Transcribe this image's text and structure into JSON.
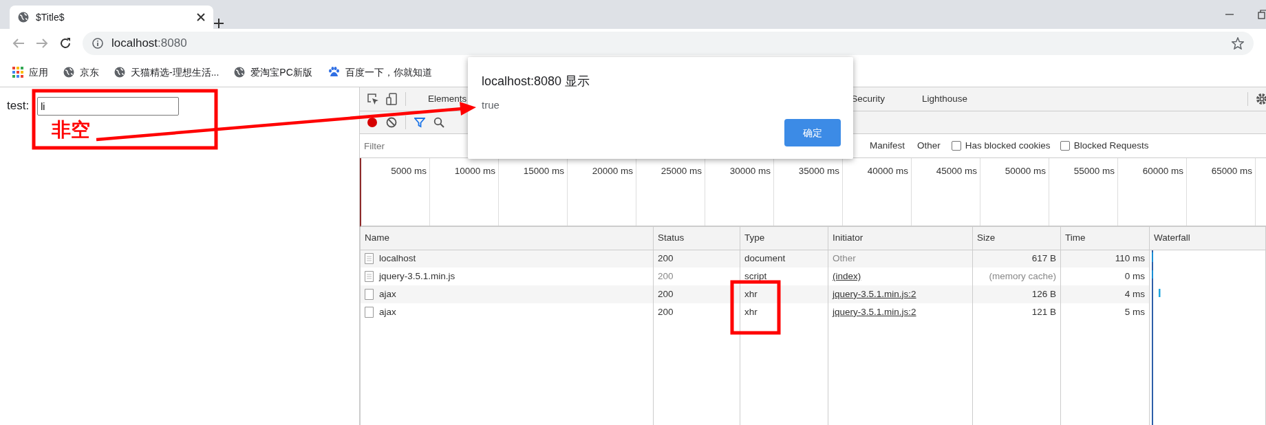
{
  "browser_tab": {
    "title": "$Title$"
  },
  "address_bar": {
    "host": "localhost",
    "port": ":8080"
  },
  "bookmarks": [
    {
      "label": "应用",
      "kind": "apps"
    },
    {
      "label": "京东",
      "kind": "globe"
    },
    {
      "label": "天猫精选-理想生活...",
      "kind": "globe"
    },
    {
      "label": "爱淘宝PC新版",
      "kind": "globe"
    },
    {
      "label": "百度一下，你就知道",
      "kind": "paw"
    }
  ],
  "page": {
    "label": "test:",
    "input_value": "li"
  },
  "devtools": {
    "tabs": [
      {
        "label": "Elements",
        "selected": false
      },
      {
        "label": "Security",
        "selected": false
      },
      {
        "label": "Lighthouse",
        "selected": false
      }
    ],
    "recording": true,
    "filter": {
      "placeholder": "Filter"
    },
    "type_filters": [
      {
        "label": "Manifest",
        "selected": false
      },
      {
        "label": "Other",
        "selected": false
      }
    ],
    "checkboxes": [
      {
        "label": "Has blocked cookies",
        "checked": false
      },
      {
        "label": "Blocked Requests",
        "checked": false
      }
    ],
    "timeline_ticks": [
      "5000 ms",
      "10000 ms",
      "15000 ms",
      "20000 ms",
      "25000 ms",
      "30000 ms",
      "35000 ms",
      "40000 ms",
      "45000 ms",
      "50000 ms",
      "55000 ms",
      "60000 ms",
      "65000 ms"
    ],
    "columns": [
      "Name",
      "Status",
      "Type",
      "Initiator",
      "Size",
      "Time",
      "Waterfall"
    ],
    "rows": [
      {
        "kind": "document",
        "name": "localhost",
        "status": "200",
        "type": "document",
        "initiator": "Other",
        "initiator_link": false,
        "size": "617 B",
        "time": "110 ms",
        "from_cache": false
      },
      {
        "kind": "document",
        "name": "jquery-3.5.1.min.js",
        "status": "200",
        "type": "script",
        "initiator": "(index)",
        "initiator_link": true,
        "size": "(memory cache)",
        "time": "0 ms",
        "from_cache": true
      },
      {
        "kind": "blank",
        "name": "ajax",
        "status": "200",
        "type": "xhr",
        "initiator": "jquery-3.5.1.min.js:2",
        "initiator_link": true,
        "size": "126 B",
        "time": "4 ms",
        "from_cache": false
      },
      {
        "kind": "blank",
        "name": "ajax",
        "status": "200",
        "type": "xhr",
        "initiator": "jquery-3.5.1.min.js:2",
        "initiator_link": true,
        "size": "121 B",
        "time": "5 ms",
        "from_cache": false
      }
    ]
  },
  "dialog": {
    "title": "localhost:8080 显示",
    "message": "true",
    "button": "确定"
  },
  "annotation": {
    "label": "非空"
  }
}
